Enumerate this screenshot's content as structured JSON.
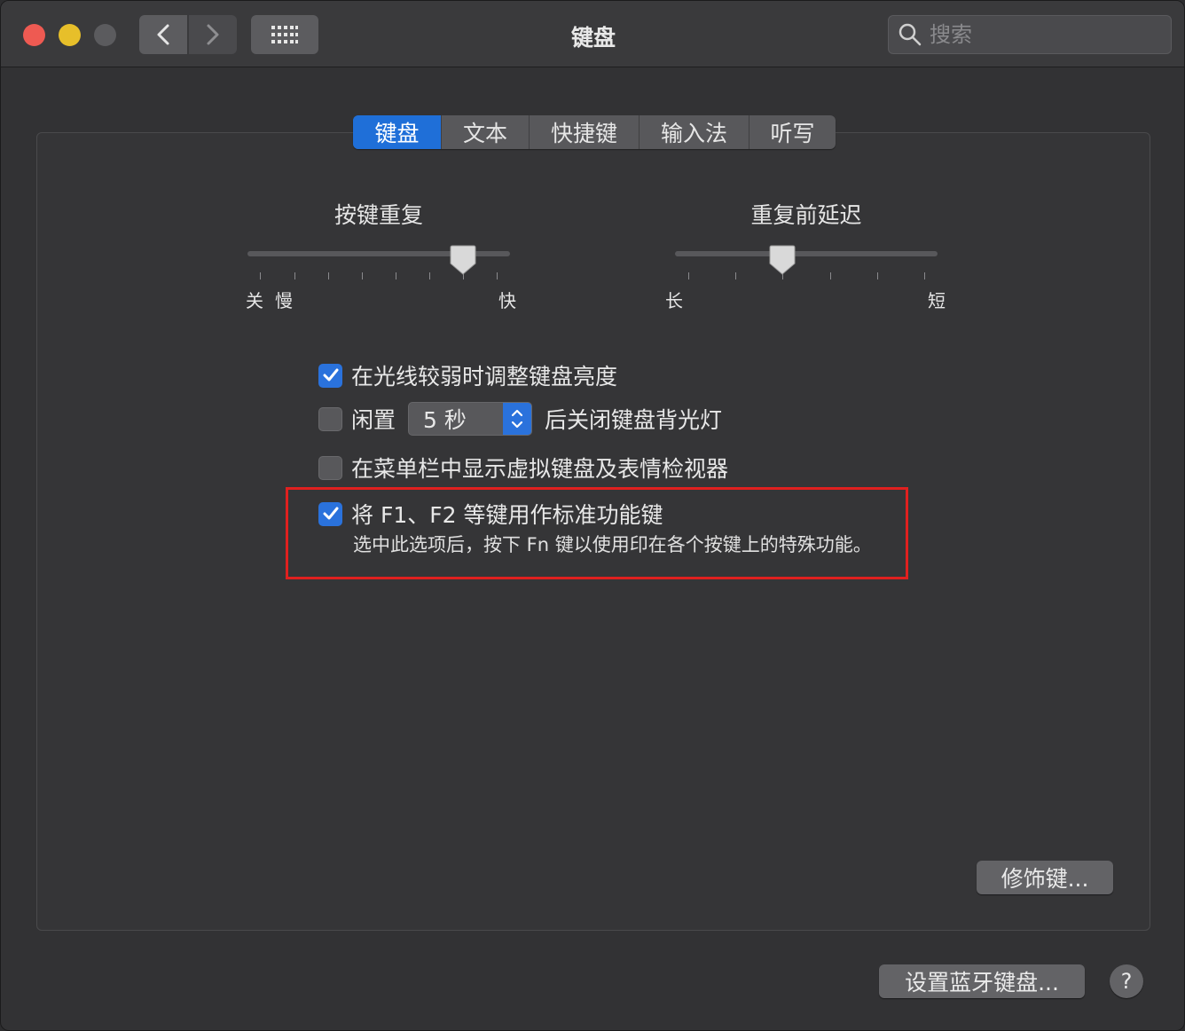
{
  "window": {
    "title": "键盘"
  },
  "toolbar": {
    "search_placeholder": "搜索"
  },
  "tabs": [
    {
      "label": "键盘",
      "active": true
    },
    {
      "label": "文本",
      "active": false
    },
    {
      "label": "快捷键",
      "active": false
    },
    {
      "label": "输入法",
      "active": false
    },
    {
      "label": "听写",
      "active": false
    }
  ],
  "key_repeat": {
    "title": "按键重复",
    "label_off": "关",
    "label_slow": "慢",
    "label_fast": "快",
    "value_fraction": 0.83
  },
  "repeat_delay": {
    "title": "重复前延迟",
    "label_long": "长",
    "label_short": "短",
    "value_fraction": 0.4
  },
  "options": {
    "adjust_brightness": {
      "label": "在光线较弱时调整键盘亮度",
      "checked": true
    },
    "backlight_off": {
      "prefix": "闲置",
      "selected": "5 秒",
      "suffix": "后关闭键盘背光灯",
      "checked": false
    },
    "show_viewer": {
      "label": "在菜单栏中显示虚拟键盘及表情检视器",
      "checked": false
    },
    "fn_keys": {
      "label": "将 F1、F2 等键用作标准功能键",
      "description": "选中此选项后，按下 Fn 键以使用印在各个按键上的特殊功能。",
      "checked": true
    }
  },
  "buttons": {
    "modifier": "修饰键...",
    "bluetooth": "设置蓝牙键盘...",
    "help": "?"
  },
  "colors": {
    "accent": "#2a72dc",
    "highlight_box": "#e0201f"
  }
}
